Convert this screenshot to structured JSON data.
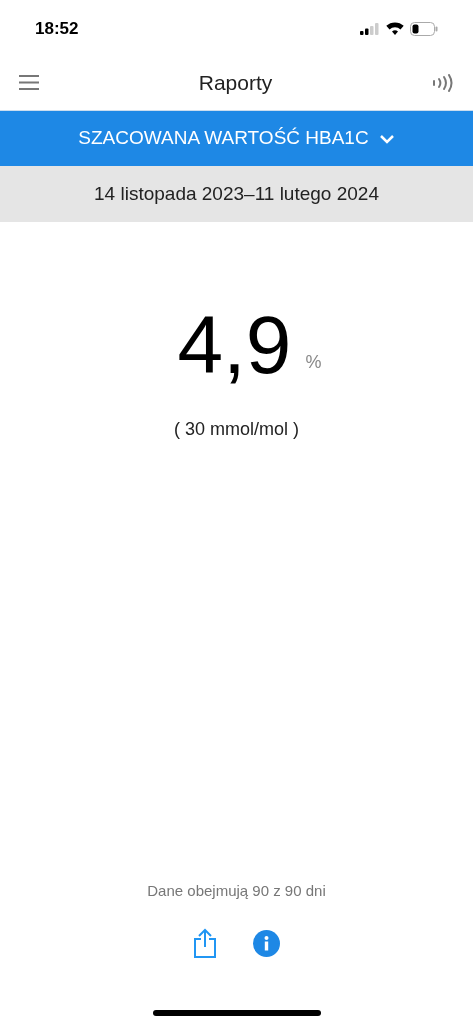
{
  "status_bar": {
    "time": "18:52"
  },
  "header": {
    "title": "Raporty"
  },
  "report_selector": {
    "label": "SZACOWANA WARTOŚĆ HBA1C"
  },
  "date_range": "14 listopada 2023–11 lutego 2024",
  "result": {
    "value": "4,9",
    "unit": "%",
    "secondary": "( 30 mmol/mol )"
  },
  "coverage": "Dane obejmują 90 z 90 dni"
}
